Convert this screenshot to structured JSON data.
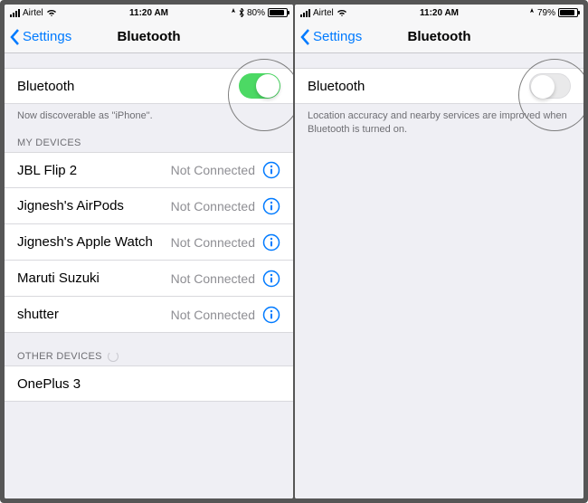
{
  "left": {
    "status": {
      "carrier": "Airtel",
      "time": "11:20 AM",
      "battery": "80%"
    },
    "nav": {
      "back": "Settings",
      "title": "Bluetooth"
    },
    "bluetooth": {
      "label": "Bluetooth",
      "on": true
    },
    "discoverable_note": "Now discoverable as \"iPhone\".",
    "my_devices_header": "MY DEVICES",
    "devices": [
      {
        "name": "JBL Flip 2",
        "status": "Not Connected"
      },
      {
        "name": "Jignesh's AirPods",
        "status": "Not Connected"
      },
      {
        "name": "Jignesh's Apple Watch",
        "status": "Not Connected"
      },
      {
        "name": "Maruti Suzuki",
        "status": "Not Connected"
      },
      {
        "name": "shutter",
        "status": "Not Connected"
      }
    ],
    "other_devices_header": "OTHER DEVICES",
    "other_devices": [
      {
        "name": "OnePlus 3"
      }
    ]
  },
  "right": {
    "status": {
      "carrier": "Airtel",
      "time": "11:20 AM",
      "battery": "79%"
    },
    "nav": {
      "back": "Settings",
      "title": "Bluetooth"
    },
    "bluetooth": {
      "label": "Bluetooth",
      "on": false
    },
    "off_note": "Location accuracy and nearby services are improved when Bluetooth is turned on."
  }
}
